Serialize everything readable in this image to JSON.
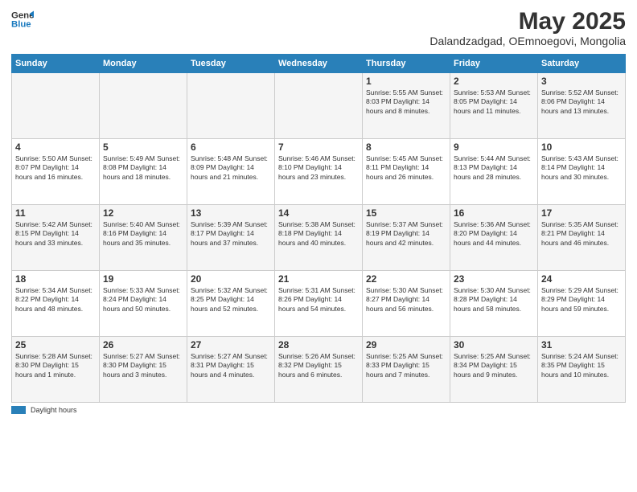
{
  "logo": {
    "line1": "General",
    "line2": "Blue"
  },
  "title": "May 2025",
  "subtitle": "Dalandzadgad, OEmnoegovi, Mongolia",
  "days_of_week": [
    "Sunday",
    "Monday",
    "Tuesday",
    "Wednesday",
    "Thursday",
    "Friday",
    "Saturday"
  ],
  "weeks": [
    [
      {
        "day": "",
        "info": ""
      },
      {
        "day": "",
        "info": ""
      },
      {
        "day": "",
        "info": ""
      },
      {
        "day": "",
        "info": ""
      },
      {
        "day": "1",
        "info": "Sunrise: 5:55 AM\nSunset: 8:03 PM\nDaylight: 14 hours\nand 8 minutes."
      },
      {
        "day": "2",
        "info": "Sunrise: 5:53 AM\nSunset: 8:05 PM\nDaylight: 14 hours\nand 11 minutes."
      },
      {
        "day": "3",
        "info": "Sunrise: 5:52 AM\nSunset: 8:06 PM\nDaylight: 14 hours\nand 13 minutes."
      }
    ],
    [
      {
        "day": "4",
        "info": "Sunrise: 5:50 AM\nSunset: 8:07 PM\nDaylight: 14 hours\nand 16 minutes."
      },
      {
        "day": "5",
        "info": "Sunrise: 5:49 AM\nSunset: 8:08 PM\nDaylight: 14 hours\nand 18 minutes."
      },
      {
        "day": "6",
        "info": "Sunrise: 5:48 AM\nSunset: 8:09 PM\nDaylight: 14 hours\nand 21 minutes."
      },
      {
        "day": "7",
        "info": "Sunrise: 5:46 AM\nSunset: 8:10 PM\nDaylight: 14 hours\nand 23 minutes."
      },
      {
        "day": "8",
        "info": "Sunrise: 5:45 AM\nSunset: 8:11 PM\nDaylight: 14 hours\nand 26 minutes."
      },
      {
        "day": "9",
        "info": "Sunrise: 5:44 AM\nSunset: 8:13 PM\nDaylight: 14 hours\nand 28 minutes."
      },
      {
        "day": "10",
        "info": "Sunrise: 5:43 AM\nSunset: 8:14 PM\nDaylight: 14 hours\nand 30 minutes."
      }
    ],
    [
      {
        "day": "11",
        "info": "Sunrise: 5:42 AM\nSunset: 8:15 PM\nDaylight: 14 hours\nand 33 minutes."
      },
      {
        "day": "12",
        "info": "Sunrise: 5:40 AM\nSunset: 8:16 PM\nDaylight: 14 hours\nand 35 minutes."
      },
      {
        "day": "13",
        "info": "Sunrise: 5:39 AM\nSunset: 8:17 PM\nDaylight: 14 hours\nand 37 minutes."
      },
      {
        "day": "14",
        "info": "Sunrise: 5:38 AM\nSunset: 8:18 PM\nDaylight: 14 hours\nand 40 minutes."
      },
      {
        "day": "15",
        "info": "Sunrise: 5:37 AM\nSunset: 8:19 PM\nDaylight: 14 hours\nand 42 minutes."
      },
      {
        "day": "16",
        "info": "Sunrise: 5:36 AM\nSunset: 8:20 PM\nDaylight: 14 hours\nand 44 minutes."
      },
      {
        "day": "17",
        "info": "Sunrise: 5:35 AM\nSunset: 8:21 PM\nDaylight: 14 hours\nand 46 minutes."
      }
    ],
    [
      {
        "day": "18",
        "info": "Sunrise: 5:34 AM\nSunset: 8:22 PM\nDaylight: 14 hours\nand 48 minutes."
      },
      {
        "day": "19",
        "info": "Sunrise: 5:33 AM\nSunset: 8:24 PM\nDaylight: 14 hours\nand 50 minutes."
      },
      {
        "day": "20",
        "info": "Sunrise: 5:32 AM\nSunset: 8:25 PM\nDaylight: 14 hours\nand 52 minutes."
      },
      {
        "day": "21",
        "info": "Sunrise: 5:31 AM\nSunset: 8:26 PM\nDaylight: 14 hours\nand 54 minutes."
      },
      {
        "day": "22",
        "info": "Sunrise: 5:30 AM\nSunset: 8:27 PM\nDaylight: 14 hours\nand 56 minutes."
      },
      {
        "day": "23",
        "info": "Sunrise: 5:30 AM\nSunset: 8:28 PM\nDaylight: 14 hours\nand 58 minutes."
      },
      {
        "day": "24",
        "info": "Sunrise: 5:29 AM\nSunset: 8:29 PM\nDaylight: 14 hours\nand 59 minutes."
      }
    ],
    [
      {
        "day": "25",
        "info": "Sunrise: 5:28 AM\nSunset: 8:30 PM\nDaylight: 15 hours\nand 1 minute."
      },
      {
        "day": "26",
        "info": "Sunrise: 5:27 AM\nSunset: 8:30 PM\nDaylight: 15 hours\nand 3 minutes."
      },
      {
        "day": "27",
        "info": "Sunrise: 5:27 AM\nSunset: 8:31 PM\nDaylight: 15 hours\nand 4 minutes."
      },
      {
        "day": "28",
        "info": "Sunrise: 5:26 AM\nSunset: 8:32 PM\nDaylight: 15 hours\nand 6 minutes."
      },
      {
        "day": "29",
        "info": "Sunrise: 5:25 AM\nSunset: 8:33 PM\nDaylight: 15 hours\nand 7 minutes."
      },
      {
        "day": "30",
        "info": "Sunrise: 5:25 AM\nSunset: 8:34 PM\nDaylight: 15 hours\nand 9 minutes."
      },
      {
        "day": "31",
        "info": "Sunrise: 5:24 AM\nSunset: 8:35 PM\nDaylight: 15 hours\nand 10 minutes."
      }
    ]
  ],
  "footer": {
    "daylight_label": "Daylight hours"
  }
}
